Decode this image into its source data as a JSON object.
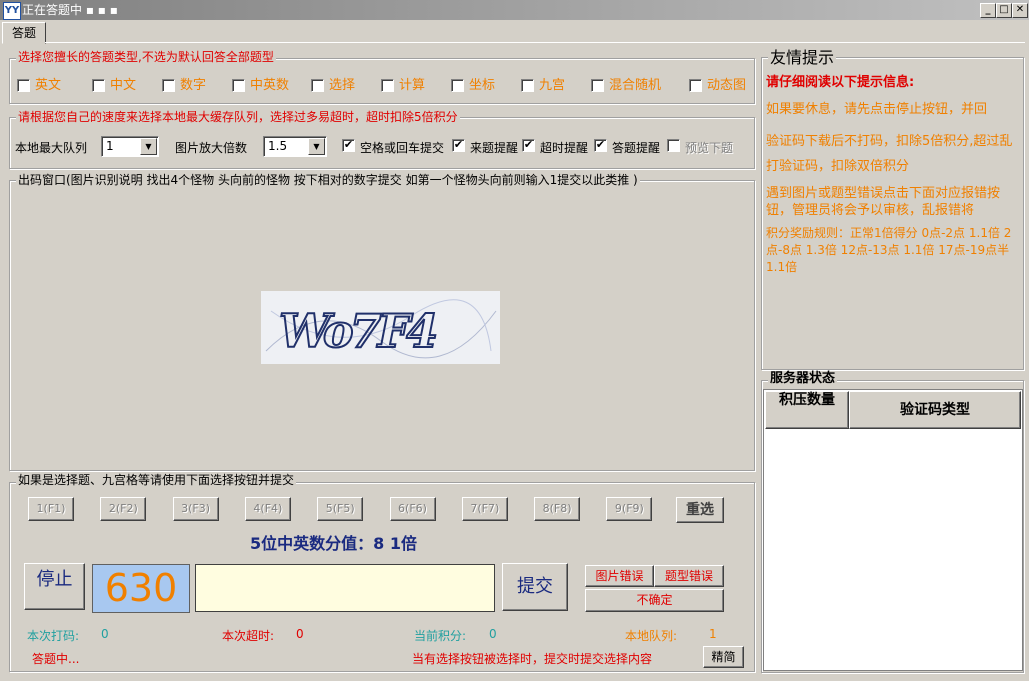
{
  "window": {
    "title": "正在答题中 ▪ ▪ ▪",
    "icon": "YY"
  },
  "tab": {
    "label": "答题"
  },
  "question_types": {
    "legend": "选择您擅长的答题类型,不选为默认回答全部题型",
    "items": [
      "英文",
      "中文",
      "数字",
      "中英数",
      "选择",
      "计算",
      "坐标",
      "九宫",
      "混合随机",
      "动态图"
    ]
  },
  "speed": {
    "legend": "请根据您自己的速度来选择本地最大缓存队列，选择过多易超时，超时扣除5倍积分",
    "max_queue_label": "本地最大队列",
    "max_queue_value": "1",
    "zoom_label": "图片放大倍数",
    "zoom_value": "1.5",
    "checks": [
      {
        "label": "空格或回车提交",
        "checked": true
      },
      {
        "label": "来题提醒",
        "checked": true
      },
      {
        "label": "超时提醒",
        "checked": true
      },
      {
        "label": "答题提醒",
        "checked": true
      },
      {
        "label": "预览下题",
        "checked": false
      }
    ]
  },
  "captcha": {
    "legend": "出码窗口(图片识别说明  找出4个怪物 头向前的怪物  按下相对的数字提交  如第一个怪物头向前则输入1提交以此类推 )",
    "image_text": "Wo7F4"
  },
  "choice": {
    "legend": "如果是选择题、九宫格等请使用下面选择按钮并提交",
    "buttons": [
      "1(F1)",
      "2(F2)",
      "3(F3)",
      "4(F4)",
      "5(F5)",
      "6(F6)",
      "7(F7)",
      "8(F8)",
      "9(F9)"
    ],
    "reset": "重选",
    "score_info": "5位中英数分值：8 1倍"
  },
  "controls": {
    "stop": "停止",
    "timer": "630",
    "answer_value": "",
    "submit": "提交",
    "img_error": "图片错误",
    "type_error": "题型错误",
    "unsure": "不确定"
  },
  "stats": {
    "this_code_label": "本次打码:",
    "this_code": "0",
    "timeout_label": "本次超时:",
    "timeout": "0",
    "points_label": "当前积分:",
    "points": "0",
    "queue_label": "本地队列:",
    "queue": "1",
    "status": "答题中...",
    "hint": "当有选择按钮被选择时，提交时提交选择内容",
    "simple": "精简"
  },
  "tips": {
    "title": "友情提示",
    "heading": "请仔细阅读以下提示信息:",
    "p1": "如果要休息，请先点击停止按钮，并回",
    "p2": "验证码下载后不打码，扣除5倍积分,超过乱打验证码，扣除双倍积分",
    "p3": "遇到图片或题型错误点击下面对应报错按钮，管理员将会予以审核，乱报错将",
    "p4": "积分奖励规则：正常1倍得分 0点-2点 1.1倍  2点-8点 1.3倍     12点-13点  1.1倍 17点-19点半  1.1倍"
  },
  "server": {
    "title": "服务器状态",
    "col1": "积压数量",
    "col2": "验证码类型"
  },
  "colors": {
    "red": "#e00000",
    "orange": "#f08000",
    "navy": "#1a2a80",
    "teal": "#20a0a0",
    "timer_bg": "#a8c8f0",
    "timer_fg": "#f08000"
  }
}
